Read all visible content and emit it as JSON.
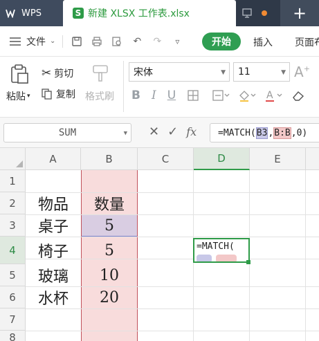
{
  "app": {
    "name": "WPS",
    "doc_tab_badge": "S",
    "doc_tab_title": "新建 XLSX 工作表.xlsx",
    "new_tab_label": "+"
  },
  "menu": {
    "file_label": "文件",
    "start_label": "开始",
    "insert_label": "插入",
    "page_label": "页面布"
  },
  "ribbon": {
    "paste_label": "粘贴",
    "cut_label": "剪切",
    "copy_label": "复制",
    "format_painter_label": "格式刷",
    "font_name": "宋体",
    "font_size": "11",
    "bold_label": "B",
    "italic_label": "I",
    "underline_label": "U",
    "font_grow_label": "A"
  },
  "formula_bar": {
    "name_box": "SUM",
    "fx_label": "fx",
    "formula_prefix": "=MATCH(",
    "formula_ref1": "B3",
    "formula_sep1": ",",
    "formula_ref2": "B:B",
    "formula_suffix": ",0)"
  },
  "grid": {
    "columns": [
      "A",
      "B",
      "C",
      "D",
      "E"
    ],
    "active_column": "D",
    "rows": [
      "1",
      "2",
      "3",
      "4",
      "5",
      "6",
      "7",
      "8"
    ],
    "active_row": "4",
    "cells": {
      "A2": "物品",
      "B2": "数量",
      "A3": "桌子",
      "B3": "5",
      "A4": "椅子",
      "B4": "5",
      "A5": "玻璃",
      "B5": "10",
      "A6": "水杯",
      "B6": "20"
    },
    "editing_cell_text": "=MATCH("
  },
  "colors": {
    "accent": "#2e9b48",
    "ref_b3": "#c8c8e8",
    "ref_bb": "#f3c8c8"
  }
}
